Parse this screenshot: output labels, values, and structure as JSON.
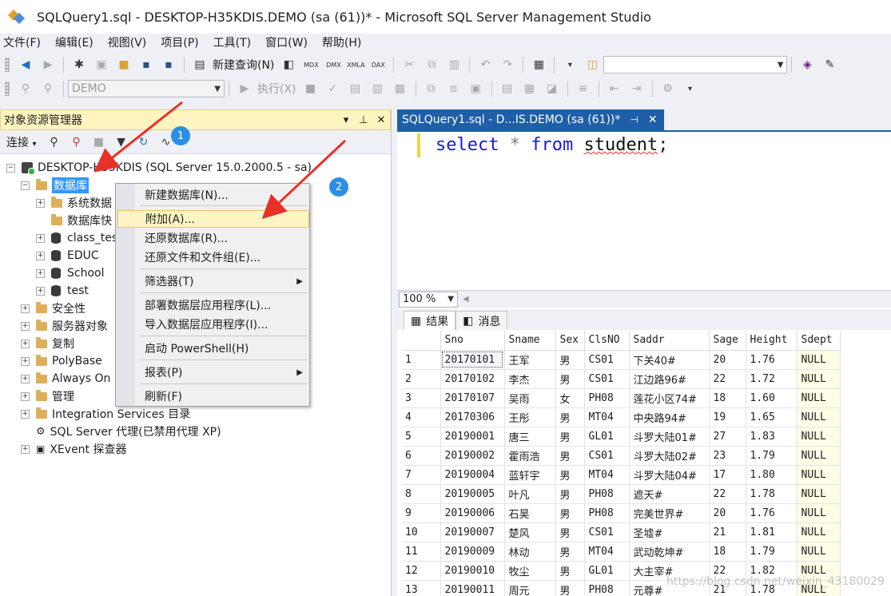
{
  "window": {
    "title": "SQLQuery1.sql - DESKTOP-H35KDIS.DEMO (sa (61))* - Microsoft SQL Server Management Studio"
  },
  "menu": [
    "文件(F)",
    "编辑(E)",
    "视图(V)",
    "项目(P)",
    "工具(T)",
    "窗口(W)",
    "帮助(H)"
  ],
  "toolbar": {
    "new_query_label": "新建查询(N)",
    "database_value": "DEMO",
    "execute_label": "执行(X)",
    "search_value": ""
  },
  "object_explorer": {
    "title": "对象资源管理器",
    "connect_label": "连接",
    "badge1": "1",
    "badge2": "2",
    "nodes": {
      "server": "DESKTOP-H35KDIS (SQL Server 15.0.2000.5 - sa)",
      "databases": "数据库",
      "system_db": "系统数据",
      "snapshots": "数据库快",
      "class_test": "class_tes",
      "educ": "EDUC",
      "school": "School",
      "test": "test",
      "security": "安全性",
      "server_objects": "服务器对象",
      "replication": "复制",
      "polybase": "PolyBase",
      "always_on": "Always On",
      "management": "管理",
      "integration": "Integration Services 目录",
      "agent": "SQL Server 代理(已禁用代理 XP)",
      "xevent": "XEvent 探查器"
    }
  },
  "context_menu": [
    "新建数据库(N)...",
    "附加(A)...",
    "还原数据库(R)...",
    "还原文件和文件组(E)...",
    "筛选器(T)",
    "部署数据层应用程序(L)...",
    "导入数据层应用程序(I)...",
    "启动 PowerShell(H)",
    "报表(P)",
    "刷新(F)"
  ],
  "editor": {
    "tab_title": "SQLQuery1.sql - D...IS.DEMO (sa (61))*",
    "code": {
      "kw1": "select",
      "op": " * ",
      "kw2": "from",
      "ident": "student",
      "end": ";"
    },
    "zoom": "100 %"
  },
  "results": {
    "tab_results": "结果",
    "tab_messages": "消息",
    "columns": [
      "",
      "Sno",
      "Sname",
      "Sex",
      "ClsNO",
      "Saddr",
      "Sage",
      "Height",
      "Sdept"
    ],
    "rows": [
      [
        "1",
        "20170101",
        "王军",
        "男",
        "CS01",
        "下关40#",
        "20",
        "1.76",
        "NULL"
      ],
      [
        "2",
        "20170102",
        "李杰",
        "男",
        "CS01",
        "江边路96#",
        "22",
        "1.72",
        "NULL"
      ],
      [
        "3",
        "20170107",
        "吴雨",
        "女",
        "PH08",
        "莲花小区74#",
        "18",
        "1.60",
        "NULL"
      ],
      [
        "4",
        "20170306",
        "王彤",
        "男",
        "MT04",
        "中央路94#",
        "19",
        "1.65",
        "NULL"
      ],
      [
        "5",
        "20190001",
        "唐三",
        "男",
        "GL01",
        "斗罗大陆01#",
        "27",
        "1.83",
        "NULL"
      ],
      [
        "6",
        "20190002",
        "霍雨浩",
        "男",
        "CS01",
        "斗罗大陆02#",
        "23",
        "1.79",
        "NULL"
      ],
      [
        "7",
        "20190004",
        "蓝轩宇",
        "男",
        "MT04",
        "斗罗大陆04#",
        "17",
        "1.80",
        "NULL"
      ],
      [
        "8",
        "20190005",
        "叶凡",
        "男",
        "PH08",
        "遮天#",
        "22",
        "1.78",
        "NULL"
      ],
      [
        "9",
        "20190006",
        "石昊",
        "男",
        "PH08",
        "完美世界#",
        "20",
        "1.76",
        "NULL"
      ],
      [
        "10",
        "20190007",
        "楚风",
        "男",
        "CS01",
        "圣墟#",
        "21",
        "1.81",
        "NULL"
      ],
      [
        "11",
        "20190009",
        "林动",
        "男",
        "MT04",
        "武动乾坤#",
        "18",
        "1.79",
        "NULL"
      ],
      [
        "12",
        "20190010",
        "牧尘",
        "男",
        "GL01",
        "大主宰#",
        "22",
        "1.82",
        "NULL"
      ],
      [
        "13",
        "20190011",
        "周元",
        "男",
        "PH08",
        "元尊#",
        "21",
        "1.78",
        "NULL"
      ]
    ]
  },
  "watermark": "https://blog.csdn.net/weixin_43180029"
}
